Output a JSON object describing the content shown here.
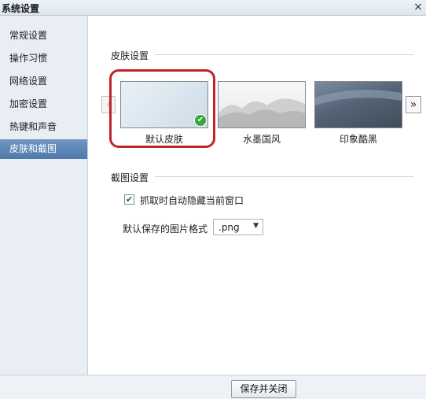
{
  "window": {
    "title": "系统设置",
    "close_symbol": "×"
  },
  "sidebar": {
    "items": [
      {
        "label": "常规设置",
        "active": false
      },
      {
        "label": "操作习惯",
        "active": false
      },
      {
        "label": "网络设置",
        "active": false
      },
      {
        "label": "加密设置",
        "active": false
      },
      {
        "label": "热键和声音",
        "active": false
      },
      {
        "label": "皮肤和截图",
        "active": true
      }
    ]
  },
  "skin_section": {
    "title": "皮肤设置",
    "prev_symbol": "‹",
    "next_symbol": "»",
    "skins": [
      {
        "label": "默认皮肤",
        "selected": true
      },
      {
        "label": "水墨国风",
        "selected": false
      },
      {
        "label": "印象酷黑",
        "selected": false
      }
    ],
    "highlight_color": "#c0232c"
  },
  "screenshot_section": {
    "title": "截图设置",
    "auto_hide": {
      "label": "抓取时自动隐藏当前窗口",
      "checked": true
    },
    "format": {
      "label": "默认保存的图片格式",
      "value": ".png"
    }
  },
  "footer": {
    "save_label": "保存并关闭"
  },
  "colors": {
    "sidebar_active": "#5b83b3",
    "check_green": "#3aa53a"
  }
}
